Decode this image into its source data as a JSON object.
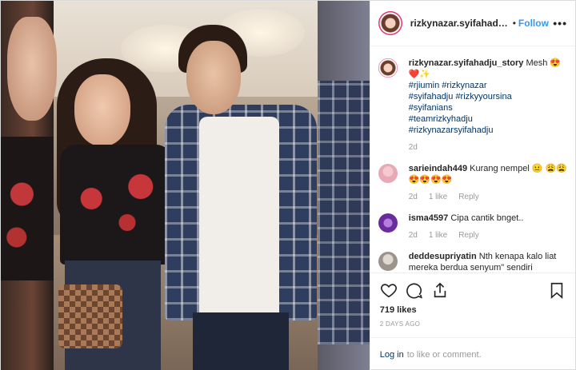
{
  "header": {
    "username": "rizkynazar.syifahadju_sto",
    "separator": "•",
    "follow_label": "Follow",
    "more_label": "•••"
  },
  "caption": {
    "username": "rizkynazar.syifahadju_story",
    "text": "Mesh 😍❤️✨",
    "tags": [
      "#rjiumin",
      "#rizkynazar",
      "#syifahadju",
      "#rizkyyoursina",
      "#syifanians",
      "#teamrizkyhadju",
      "#rizkynazarsyifahadju"
    ],
    "age": "2d"
  },
  "comments": [
    {
      "username": "sarieindah449",
      "text": "Kurang nempel 😐 😩😩😍😍😍😍",
      "age": "2d",
      "likes": "1 like",
      "reply": "Reply"
    },
    {
      "username": "isma4597",
      "text": "Cipa cantik bnget..",
      "age": "2d",
      "likes": "1 like",
      "reply": "Reply"
    },
    {
      "username": "deddesupriyatin",
      "text": "Nth kenapa kalo liat mereka berdua senyum\" sendiri",
      "age": "",
      "likes": "",
      "reply": ""
    }
  ],
  "stats": {
    "likes": "719 likes",
    "date": "2 DAYS AGO"
  },
  "login": {
    "link": "Log in",
    "text": "to like or comment."
  },
  "icons": [
    "heart-icon",
    "comment-icon",
    "share-icon",
    "bookmark-icon"
  ]
}
